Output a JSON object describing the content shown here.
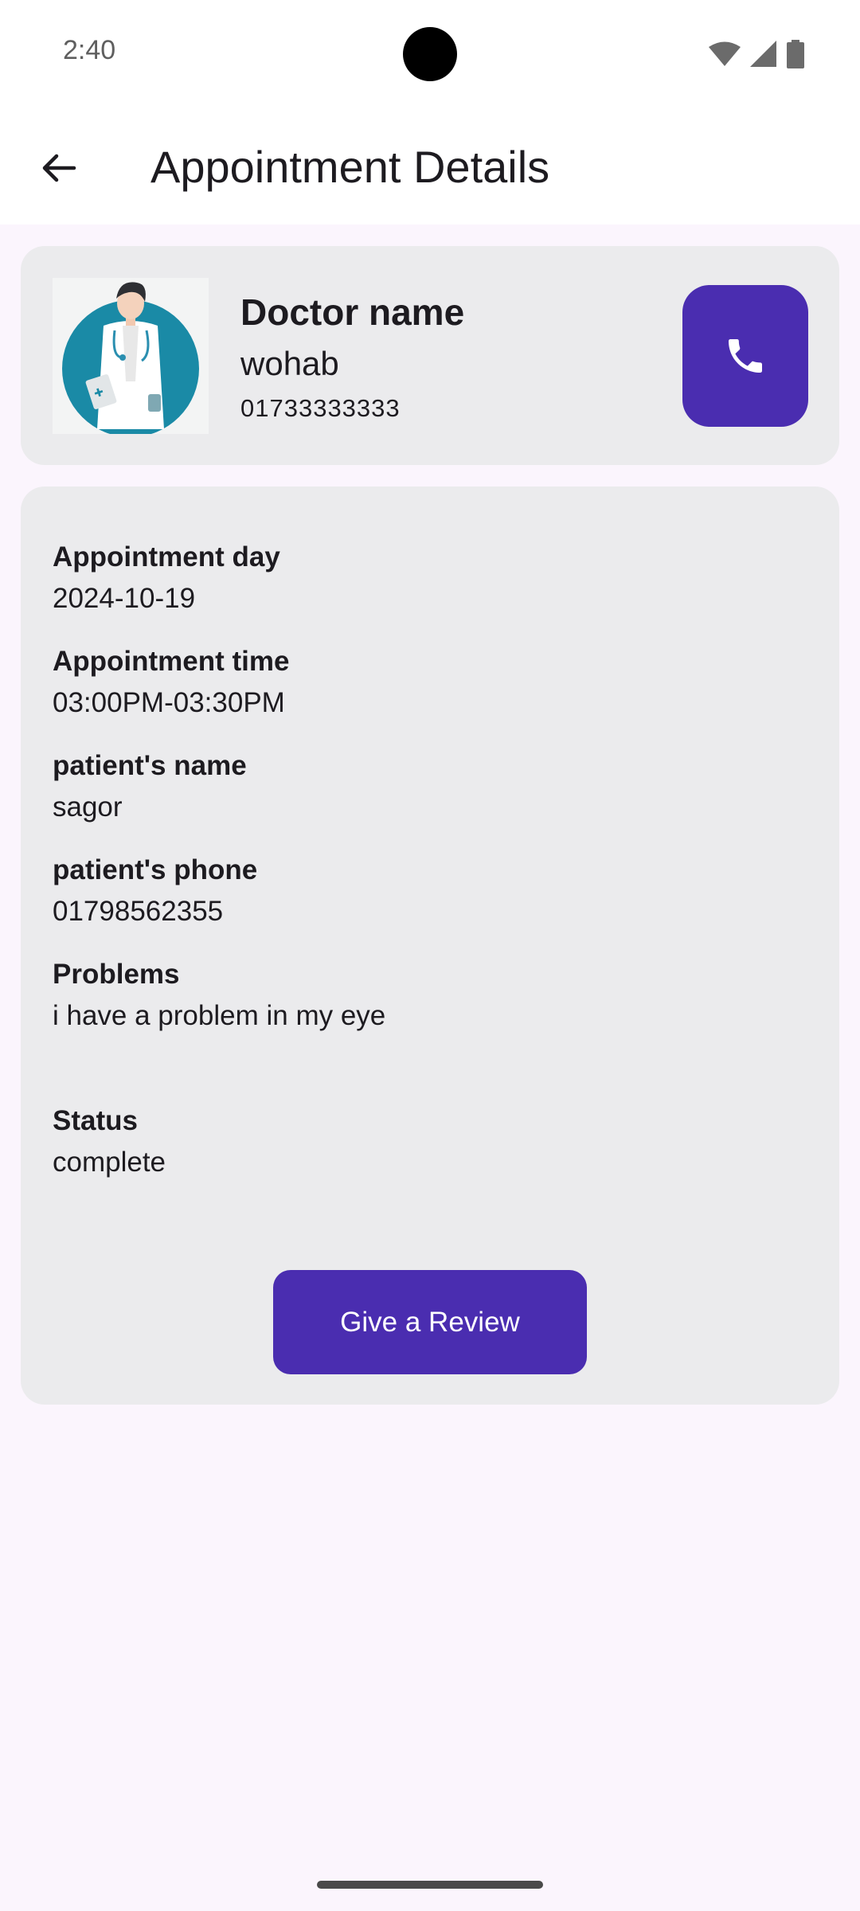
{
  "status_bar": {
    "time": "2:40"
  },
  "app_bar": {
    "title": "Appointment Details"
  },
  "doctor": {
    "label": "Doctor name",
    "name": "wohab",
    "phone": "01733333333"
  },
  "details": [
    {
      "label": "Appointment day",
      "value": "2024-10-19"
    },
    {
      "label": "Appointment time",
      "value": "03:00PM-03:30PM"
    },
    {
      "label": "patient's name",
      "value": "sagor"
    },
    {
      "label": "patient's phone",
      "value": "01798562355"
    },
    {
      "label": "Problems",
      "value": "i have a problem in my eye"
    },
    {
      "label": "Status",
      "value": "complete"
    }
  ],
  "review_button": {
    "label": "Give a Review"
  },
  "colors": {
    "accent": "#4a2db0",
    "card": "#ebebed",
    "background": "#fbf5fd"
  },
  "icons": [
    "back-arrow-icon",
    "phone-icon",
    "wifi-icon",
    "signal-icon",
    "battery-icon"
  ]
}
